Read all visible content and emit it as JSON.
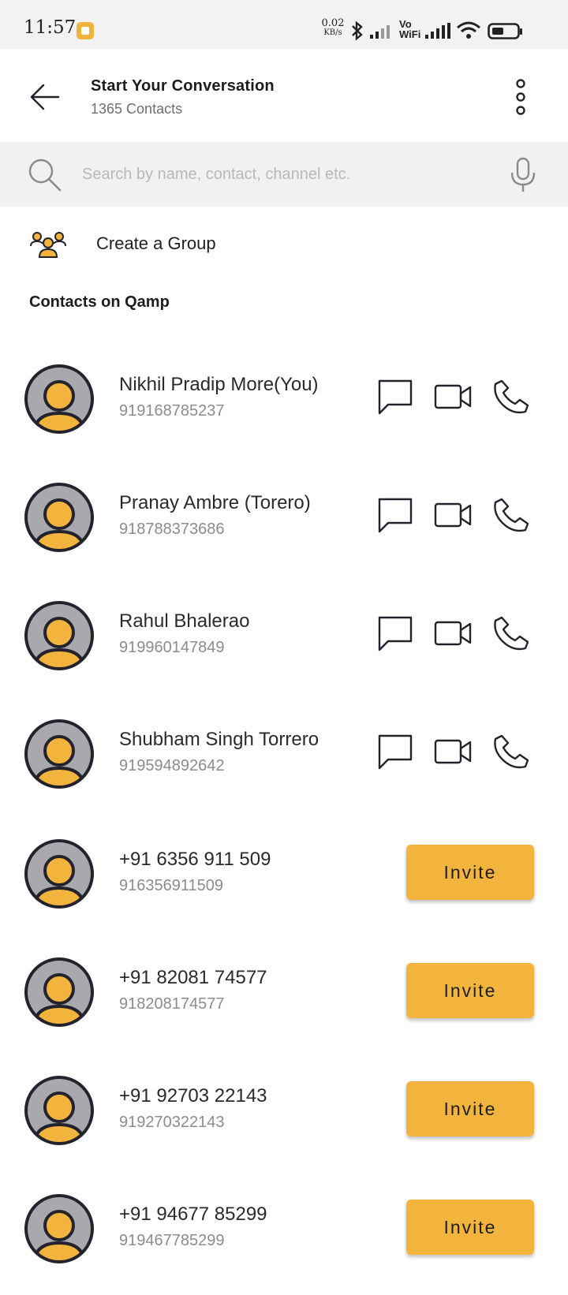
{
  "status_bar": {
    "time": "11:57",
    "net_speed_value": "0.02",
    "net_speed_unit": "KB/s",
    "icons": [
      "notification-icon",
      "bluetooth-icon",
      "signal-icon",
      "vowifi-icon",
      "signal-icon",
      "wifi-icon",
      "battery-icon"
    ],
    "vowifi_top": "Vo",
    "vowifi_bottom": "WiFi"
  },
  "header": {
    "title": "Start Your Conversation",
    "subtitle": "1365 Contacts"
  },
  "search": {
    "placeholder": "Search by name, contact, channel etc."
  },
  "create_group": {
    "label": "Create a Group"
  },
  "section": {
    "title": "Contacts on Qamp"
  },
  "contacts": [
    {
      "name": "Nikhil Pradip More(You)",
      "number": "919168785237",
      "on_qamp": true
    },
    {
      "name": "Pranay Ambre (Torero)",
      "number": "918788373686",
      "on_qamp": true
    },
    {
      "name": "Rahul Bhalerao",
      "number": "919960147849",
      "on_qamp": true
    },
    {
      "name": "Shubham Singh Torrero",
      "number": "919594892642",
      "on_qamp": true
    },
    {
      "name": "+91 6356 911 509",
      "number": "916356911509",
      "on_qamp": false,
      "action": "Invite"
    },
    {
      "name": "+91 82081 74577",
      "number": "918208174577",
      "on_qamp": false,
      "action": "Invite"
    },
    {
      "name": "+91 92703 22143",
      "number": "919270322143",
      "on_qamp": false,
      "action": "Invite"
    },
    {
      "name": "+91 94677 85299",
      "number": "919467785299",
      "on_qamp": false,
      "action": "Invite"
    }
  ],
  "colors": {
    "accent": "#f3b43d",
    "avatar_bg": "#a8a8ad",
    "avatar_outline": "#23232e",
    "icon_stroke": "#23232e"
  }
}
